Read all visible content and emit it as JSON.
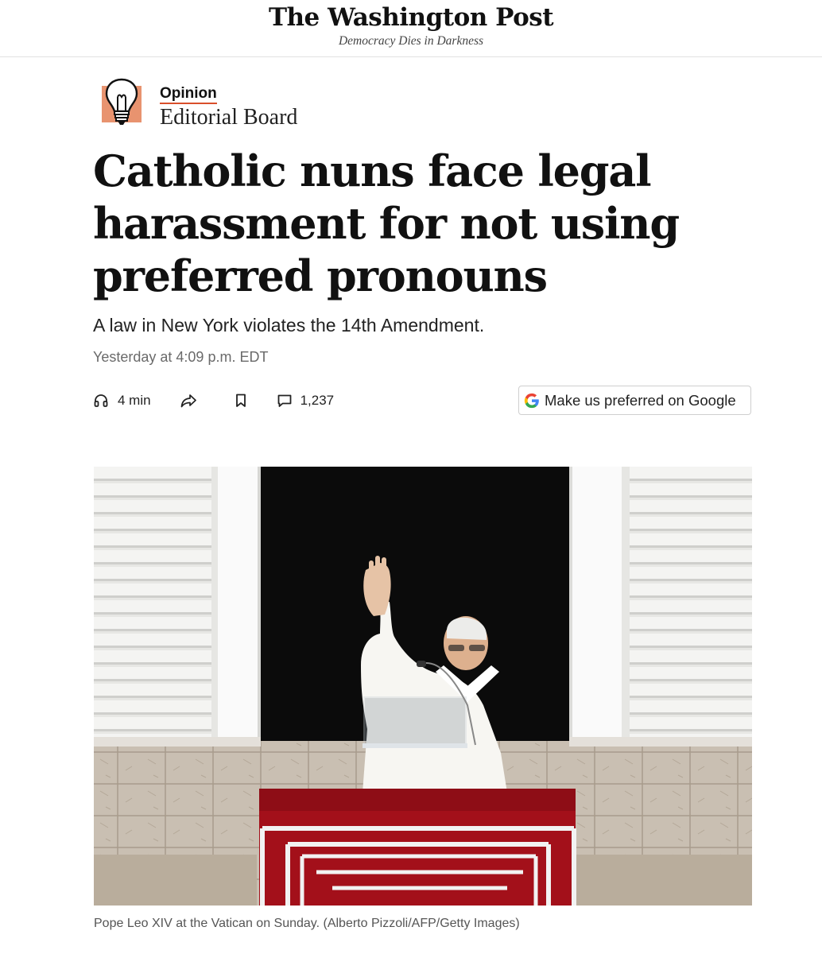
{
  "masthead": {
    "logo": "The Washington Post",
    "tagline": "Democracy Dies in Darkness"
  },
  "kicker": {
    "icon": "lightbulb-icon",
    "icon_bg_color": "#e8936f",
    "label": "Opinion",
    "author": "Editorial Board"
  },
  "article": {
    "headline": "Catholic nuns face legal harassment for not using preferred pronouns",
    "dek": "A law in New York violates the 14th Amendment.",
    "timestamp": "Yesterday at 4:09 p.m. EDT"
  },
  "toolbar": {
    "listen": {
      "icon": "headphones-icon",
      "label": "4 min"
    },
    "share": {
      "icon": "share-icon"
    },
    "save": {
      "icon": "bookmark-icon"
    },
    "comments": {
      "icon": "comment-icon",
      "count": "1,237"
    }
  },
  "google_button": {
    "icon": "google-g-icon",
    "label": "Make us preferred on Google"
  },
  "photo": {
    "caption": "Pope Leo XIV at the Vatican on Sunday. (Alberto Pizzoli/AFP/Getty Images)"
  },
  "colors": {
    "accent": "#d94f2b",
    "drape_red": "#a3101a",
    "text": "#111111",
    "muted": "#6a6a6a"
  }
}
